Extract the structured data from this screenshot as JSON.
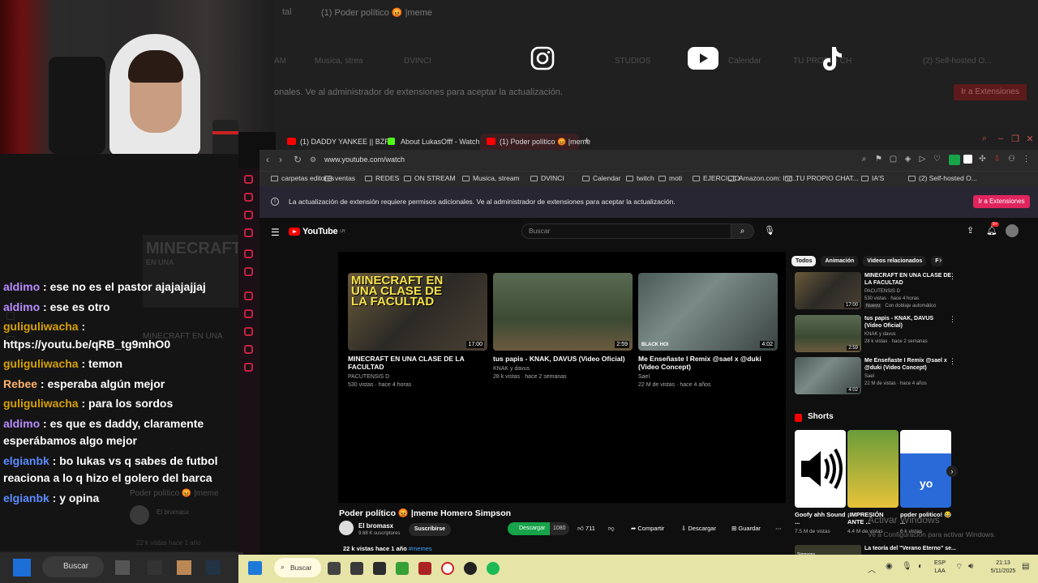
{
  "background": {
    "tabs": [
      "tal",
      "(1) Poder político 😡 |meme"
    ],
    "notice": "onales. Ve al administrador de extensiones para aceptar la actualización.",
    "button": "Ir a Extensiones",
    "bookmarks": [
      "AM",
      "Musica, strea",
      "DVINCI",
      "Calendar",
      "STUDIOS",
      "TU PROPIO CH",
      "(2) Self-hosted O..."
    ],
    "social_icons": [
      "instagram-icon",
      "youtube-icon",
      "tiktok-icon"
    ]
  },
  "chat": {
    "overlay_title": "MINECRAFT",
    "overlay_sub": "EN UNA",
    "overlay_sub2": "DE LA",
    "overlay_caption": "MINECRAFT EN UNA CLA",
    "messages": [
      {
        "user": "aldimo",
        "color": "#b88cff",
        "text": " : ese no es el pastor ajajajajjaj"
      },
      {
        "user": "aldimo",
        "color": "#b88cff",
        "text": " : ese es otro"
      },
      {
        "user": "guliguliwacha",
        "color": "#d6a100",
        "text": " : https://youtu.be/qRB_tg9mhO0"
      },
      {
        "user": "guliguliwacha",
        "color": "#d6a100",
        "text": " : temon"
      },
      {
        "user": "Rebee",
        "color": "#ffb36b",
        "text": " : esperaba algún mejor"
      },
      {
        "user": "guliguliwacha",
        "color": "#d6a100",
        "text": " : para los sordos"
      },
      {
        "user": "aldimo",
        "color": "#b88cff",
        "text": " : es que es daddy, claramente esperábamos algo mejor"
      },
      {
        "user": "elgianbk",
        "color": "#5b8cff",
        "text": " : bo lukas vs q sabes de futbol reaciona a lo q hizo el golero del barca"
      },
      {
        "user": "elgianbk",
        "color": "#5b8cff",
        "text": " : y opina"
      }
    ],
    "ghost_title": "Poder político 😡 |meme",
    "ghost_channel": "El bromasx",
    "ghost_views": "22 k vistas  hace 1 año"
  },
  "browser": {
    "tabs": [
      "(1) DADDY YANKEE || BZR",
      "About LukasOfff - Watch",
      "(1) Poder político 😡 |meme"
    ],
    "url": "www.youtube.com/watch",
    "bookmarks": [
      "carpetas editores",
      "ventas",
      "REDES",
      "ON STREAM",
      "Musica, stream",
      "DVINCI",
      "Calendar",
      "twitch",
      "moti",
      "EJERCICIO",
      "Amazon.com: Inn...",
      "TU PROPIO CHAT...",
      "IA'S",
      "(2) Self-hosted O..."
    ],
    "notice": "La actualización de extensión requiere permisos adicionales. Ve al administrador de extensiones para aceptar la actualización.",
    "notice_button": "Ir a Extensiones"
  },
  "youtube": {
    "logo": "YouTube",
    "logo_region": "UY",
    "search_placeholder": "Buscar",
    "notif_count": "9+",
    "endscreen": [
      {
        "title": "MINECRAFT EN UNA CLASE DE LA FACULTAD",
        "channel": "PACUTENSIS D",
        "meta": "530 vistas · hace 4 horas",
        "dur": "17:00",
        "thumb_text": "MINECRAFT EN UNA CLASE DE LA FACULTAD"
      },
      {
        "title": "tus papis - KNAK, DAVUS (Video Oficial)",
        "channel": "KNAK y davus",
        "meta": "28 k vistas · hace 2 semanas",
        "dur": "2:59"
      },
      {
        "title": "Me Enseñaste I Remix @sael x @duki (Video Concept)",
        "channel": "Sael",
        "meta": "22 M de vistas · hace 4 años",
        "dur": "4:02",
        "thumb_text": "BLACK HOI"
      }
    ],
    "video_title": "Poder político 😡 |meme Homero Simpson",
    "channel": "El bromasx",
    "subscribers": "9.68 K suscriptores",
    "subscribe": "Suscribirse",
    "download_green": "Descargar",
    "download_count": "1080",
    "likes": "711",
    "share": "Compartir",
    "download": "Descargar",
    "save": "Guardar",
    "views": "22 k vistas  hace 1 año",
    "hashtag": "#memes",
    "chips": [
      "Todos",
      "Animación",
      "Videos relacionados",
      "F"
    ],
    "related": [
      {
        "title": "MINECRAFT EN UNA CLASE DE LA FACULTAD",
        "channel": "PACUTENSIS D",
        "meta": "530 vistas · hace 4 horas",
        "dur": "17:00",
        "badge1": "Nuevo",
        "badge2": "Con doblaje automático"
      },
      {
        "title": "tus papis - KNAK, DAVUS (Video Oficial)",
        "channel": "KNAK y davus",
        "meta": "28 k vistas · hace 2 semanas",
        "dur": "2:59"
      },
      {
        "title": "Me Enseñaste I Remix @sael x @duki (Video Concept)",
        "channel": "Sael",
        "meta": "22 M de vistas · hace 4 años",
        "dur": "4:02"
      }
    ],
    "shorts_label": "Shorts",
    "shorts": [
      {
        "title": "Goofy ahh Sound ...",
        "views": "7.5 M de vistas"
      },
      {
        "title": "¡IMPRESIÓN ANTE ...",
        "views": "4.4 M de vistas"
      },
      {
        "title": "poder politico! 😂 ...",
        "views": "6 k vistas",
        "overlay": "yo"
      }
    ],
    "bottom_related": "La teoría del \"Verano Eterno\" se...",
    "bottom_badge": "Simpsons",
    "activate_title": "Activar Windows",
    "activate_sub": "Ve a Configuración para activar Windows."
  },
  "taskbar": {
    "search": "Buscar",
    "lang": "ESP",
    "lang2": "LAA",
    "time": "21:13",
    "date": "5/11/2025"
  }
}
